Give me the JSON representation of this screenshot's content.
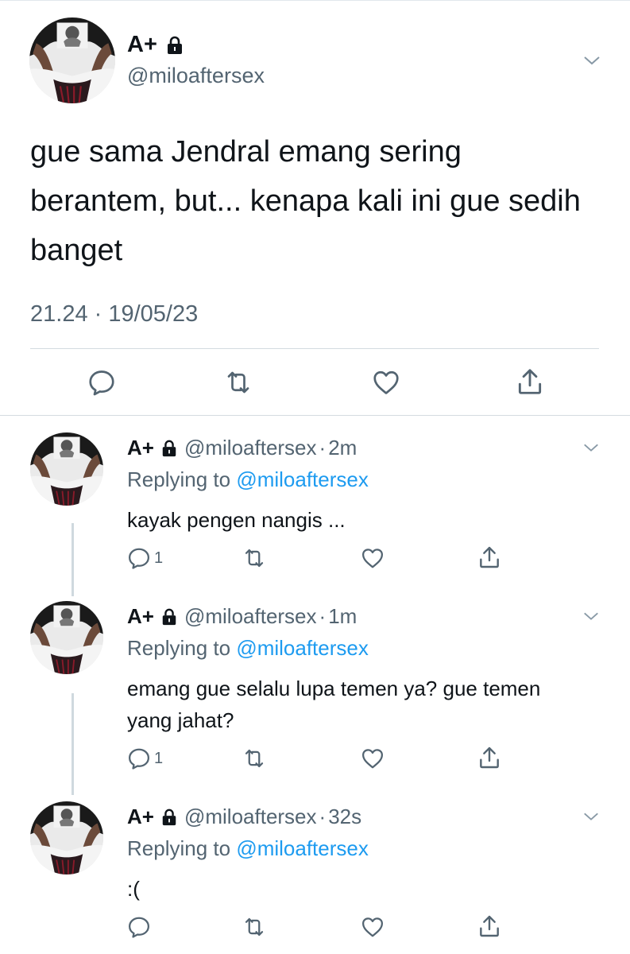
{
  "main_tweet": {
    "display_name": "A+",
    "handle": "@miloaftersex",
    "text": "gue sama Jendral emang sering berantem, but... kenapa kali ini gue sedih banget",
    "timestamp": "21.24 · 19/05/23",
    "icons": [
      "reply-icon",
      "retweet-icon",
      "like-icon",
      "share-icon"
    ]
  },
  "replies": [
    {
      "display_name": "A+",
      "handle": "@miloaftersex",
      "dot": "·",
      "time": "2m",
      "replying_prefix": "Replying to",
      "replying_to": "@miloaftersex",
      "text": "kayak pengen nangis ...",
      "reply_count": "1"
    },
    {
      "display_name": "A+",
      "handle": "@miloaftersex",
      "dot": "·",
      "time": "1m",
      "replying_prefix": "Replying to",
      "replying_to": "@miloaftersex",
      "text": "emang gue selalu lupa temen ya? gue temen yang jahat?",
      "reply_count": "1"
    },
    {
      "display_name": "A+",
      "handle": "@miloaftersex",
      "dot": "·",
      "time": "32s",
      "replying_prefix": "Replying to",
      "replying_to": "@miloaftersex",
      "text": ":(",
      "reply_count": ""
    }
  ],
  "colors": {
    "text": "#0f1419",
    "secondary": "#536471",
    "link": "#1d9bf0",
    "divider": "#d4dbe0"
  }
}
